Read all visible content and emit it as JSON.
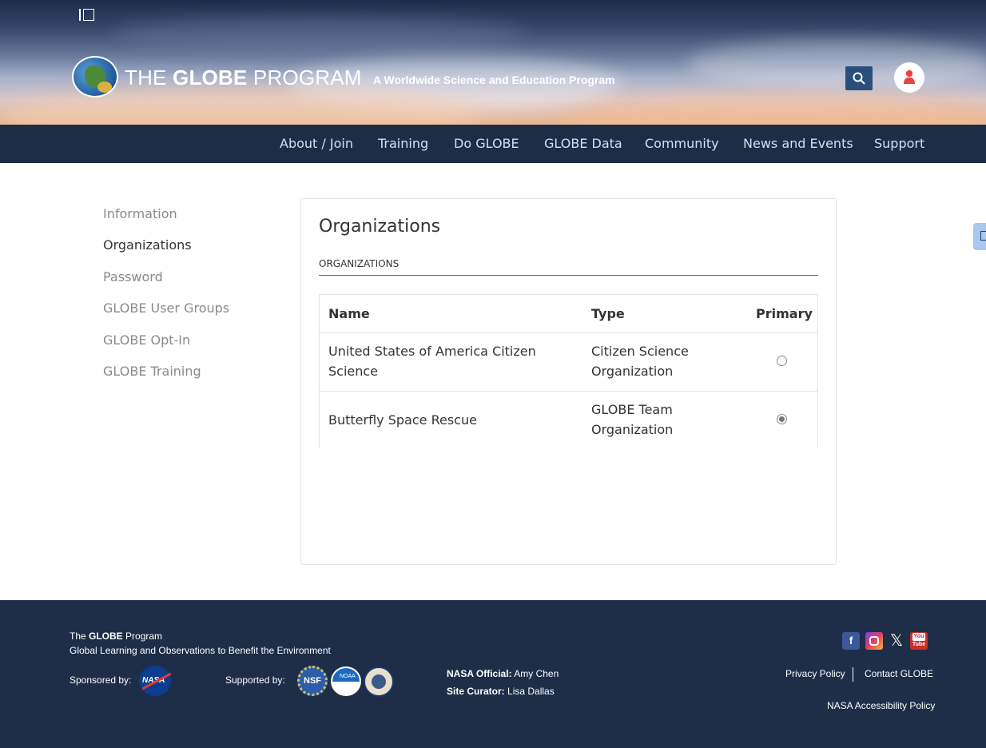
{
  "header": {
    "brand_prefix": "THE ",
    "brand_bold": "GLOBE",
    "brand_suffix": " PROGRAM",
    "tagline": "A Worldwide Science and Education Program",
    "search_icon": "search-icon",
    "user_icon": "user-icon",
    "colors": {
      "search_bg": "#2a4f7a",
      "user_icon": "#e8433e"
    }
  },
  "nav": {
    "items": [
      "About / Join",
      "Training",
      "Do GLOBE",
      "GLOBE Data",
      "Community",
      "News and Events",
      "Support"
    ]
  },
  "sidebar": {
    "items": [
      "Information",
      "Organizations",
      "Password",
      "GLOBE User Groups",
      "GLOBE Opt-In",
      "GLOBE Training"
    ],
    "active": "Organizations"
  },
  "panel": {
    "title": "Organizations",
    "section_label": "ORGANIZATIONS",
    "table": {
      "headers": [
        "Name",
        "Type",
        "Primary"
      ],
      "rows": [
        {
          "name_line1": "United States of America Citizen",
          "name_line2": "Science",
          "type_line1": "Citizen Science",
          "type_line2": "Organization",
          "primary": false
        },
        {
          "name_line1": "Butterfly Space Rescue",
          "name_line2": "",
          "type_line1": "GLOBE Team",
          "type_line2": "Organization",
          "primary": true
        }
      ]
    }
  },
  "footer": {
    "program_prefix": "The ",
    "program_bold": "GLOBE",
    "program_suffix": " Program",
    "subtitle": "Global Learning and Observations to Benefit the Environment",
    "sponsored_label": "Sponsored by:",
    "supported_label": "Supported by:",
    "nasa_official_label": "NASA Official:",
    "nasa_official_name": "Amy Chen",
    "site_curator_label": "Site Curator:",
    "site_curator_name": "Lisa Dallas",
    "links": [
      "Privacy Policy",
      "Contact GLOBE",
      "NASA Accessibility Policy"
    ],
    "social": [
      "facebook-icon",
      "instagram-icon",
      "x-icon",
      "youtube-icon"
    ],
    "logos": [
      "nasa-logo",
      "nsf-logo",
      "noaa-logo",
      "state-department-seal"
    ],
    "nasa_logo_text": "NASA",
    "nsf_logo_text": "NSF",
    "noaa_logo_text": "NOAA",
    "youtube_text_top": "You",
    "youtube_text_bottom": "Tube"
  }
}
